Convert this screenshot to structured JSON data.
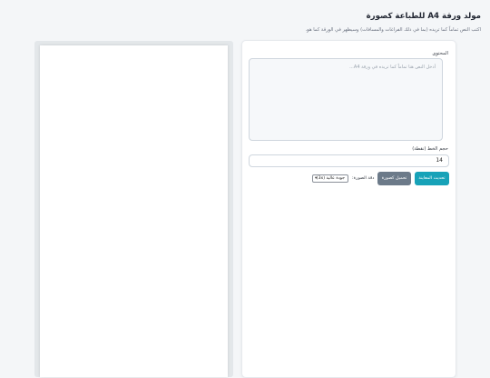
{
  "header": {
    "title": "مولد ورقة A4 للطباعة كصورة",
    "subtitle": "اكتب النص تماماً كما تريده (بما في ذلك الفراغات والمسافات) وسيظهر في الورقة كما هو."
  },
  "controls": {
    "content_label": "المحتوى",
    "content_placeholder": "أدخل النص هنا تماماً كما تريده في ورقة A4...",
    "fontsize_label": "حجم الخط (نقطة)",
    "fontsize_value": "14",
    "update_button": "تحديث المعاينة",
    "download_button": "تحميل كصورة",
    "quality_label": "دقة الصورة:",
    "quality_selected": "جودة عالية (3x)"
  }
}
